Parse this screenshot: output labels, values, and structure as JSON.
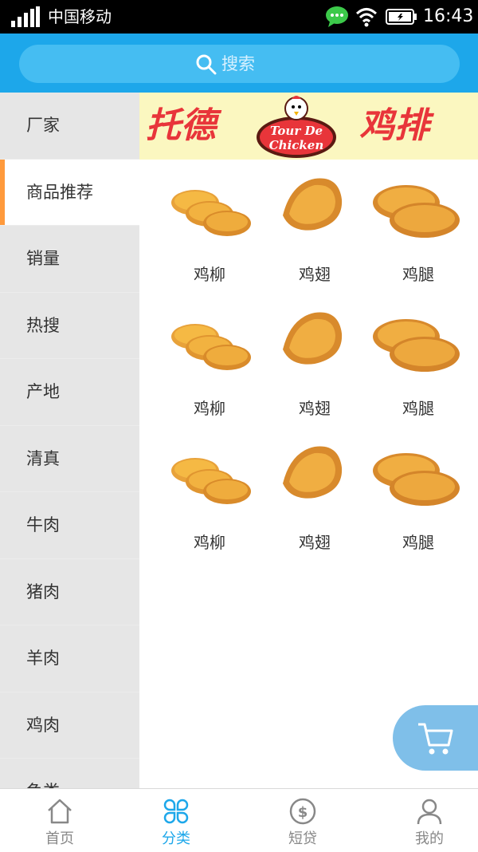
{
  "status_bar": {
    "carrier": "中国移动",
    "time": "16:43",
    "icons": [
      "signal-icon",
      "chat-icon",
      "wifi-icon",
      "battery-icon"
    ]
  },
  "search": {
    "placeholder": "搜索"
  },
  "sidebar": {
    "items": [
      {
        "label": "厂家",
        "active": false
      },
      {
        "label": "商品推荐",
        "active": true
      },
      {
        "label": "销量",
        "active": false
      },
      {
        "label": "热搜",
        "active": false
      },
      {
        "label": "产地",
        "active": false
      },
      {
        "label": "清真",
        "active": false
      },
      {
        "label": "牛肉",
        "active": false
      },
      {
        "label": "猪肉",
        "active": false
      },
      {
        "label": "羊肉",
        "active": false
      },
      {
        "label": "鸡肉",
        "active": false
      },
      {
        "label": "鱼类",
        "active": false
      }
    ]
  },
  "banner": {
    "left_text": "托德",
    "right_text": "鸡排",
    "logo_text_1": "Tour De",
    "logo_text_2": "Chicken"
  },
  "products": [
    {
      "name": "鸡柳",
      "image": "chicken-strips"
    },
    {
      "name": "鸡翅",
      "image": "chicken-wing"
    },
    {
      "name": "鸡腿",
      "image": "chicken-leg"
    },
    {
      "name": "鸡柳",
      "image": "chicken-strips"
    },
    {
      "name": "鸡翅",
      "image": "chicken-wing"
    },
    {
      "name": "鸡腿",
      "image": "chicken-leg"
    },
    {
      "name": "鸡柳",
      "image": "chicken-strips"
    },
    {
      "name": "鸡翅",
      "image": "chicken-wing"
    },
    {
      "name": "鸡腿",
      "image": "chicken-leg"
    }
  ],
  "bottom_nav": {
    "tabs": [
      {
        "label": "首页",
        "icon": "home-icon",
        "active": false
      },
      {
        "label": "分类",
        "icon": "category-icon",
        "active": true
      },
      {
        "label": "短贷",
        "icon": "dollar-icon",
        "active": false
      },
      {
        "label": "我的",
        "icon": "user-icon",
        "active": false
      }
    ]
  },
  "colors": {
    "accent": "#1da7ea",
    "active_marker": "#ff9a3c",
    "banner_text": "#e8353a"
  }
}
